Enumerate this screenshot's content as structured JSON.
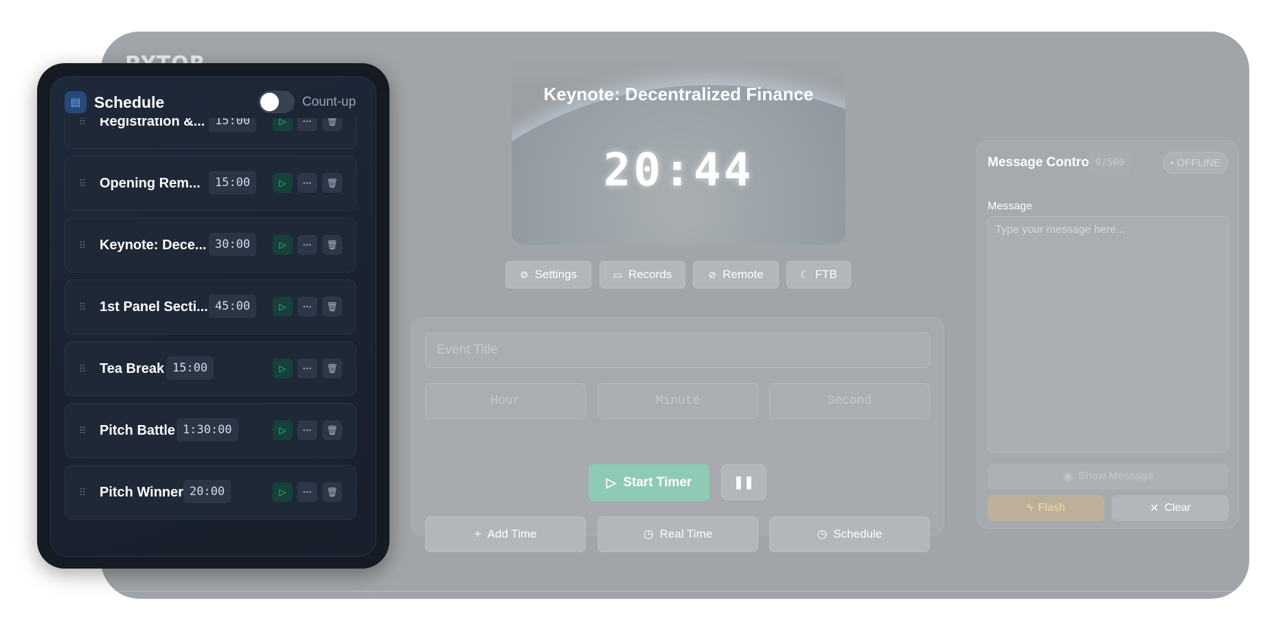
{
  "app": {
    "logo_text": "PYTOR",
    "preview": {
      "title": "Keynote: Decentralized Finance",
      "time": "20:44"
    },
    "toolbar": [
      {
        "label": "Settings",
        "icon": "gear-icon"
      },
      {
        "label": "Records",
        "icon": "calendar-icon"
      },
      {
        "label": "Remote",
        "icon": "wifi-off-icon"
      },
      {
        "label": "FTB",
        "icon": "moon-icon"
      }
    ],
    "event_form": {
      "title_placeholder": "Event Title",
      "hour_placeholder": "Hour",
      "minute_placeholder": "Minute",
      "second_placeholder": "Second",
      "start_label": "Start Timer",
      "add_time_label": "Add Time",
      "real_time_label": "Real Time",
      "schedule_label": "Schedule"
    },
    "message_control": {
      "title": "Message Control",
      "count": "0/500",
      "status": "• OFFLINE",
      "message_label": "Message",
      "placeholder": "Type your message here...",
      "show_label": "Show Message",
      "flash_label": "Flash",
      "clear_label": "Clear"
    }
  },
  "schedule": {
    "title": "Schedule",
    "toggle_label": "Count-up",
    "toggle_on": false,
    "items": [
      {
        "name": "Registration &...",
        "duration": "15:00"
      },
      {
        "name": "Opening Rem...",
        "duration": "15:00"
      },
      {
        "name": "Keynote: Dece...",
        "duration": "30:00"
      },
      {
        "name": "1st Panel Secti...",
        "duration": "45:00"
      },
      {
        "name": "Tea Break",
        "duration": "15:00"
      },
      {
        "name": "Pitch Battle",
        "duration": "1:30:00"
      },
      {
        "name": "Pitch Winner",
        "duration": "20:00"
      }
    ]
  },
  "colors": {
    "schedule_bg": "#151a23",
    "play_accent": "#2fd08f",
    "start_button": "#8fcbb4",
    "flash_button": "#bcb09a"
  }
}
